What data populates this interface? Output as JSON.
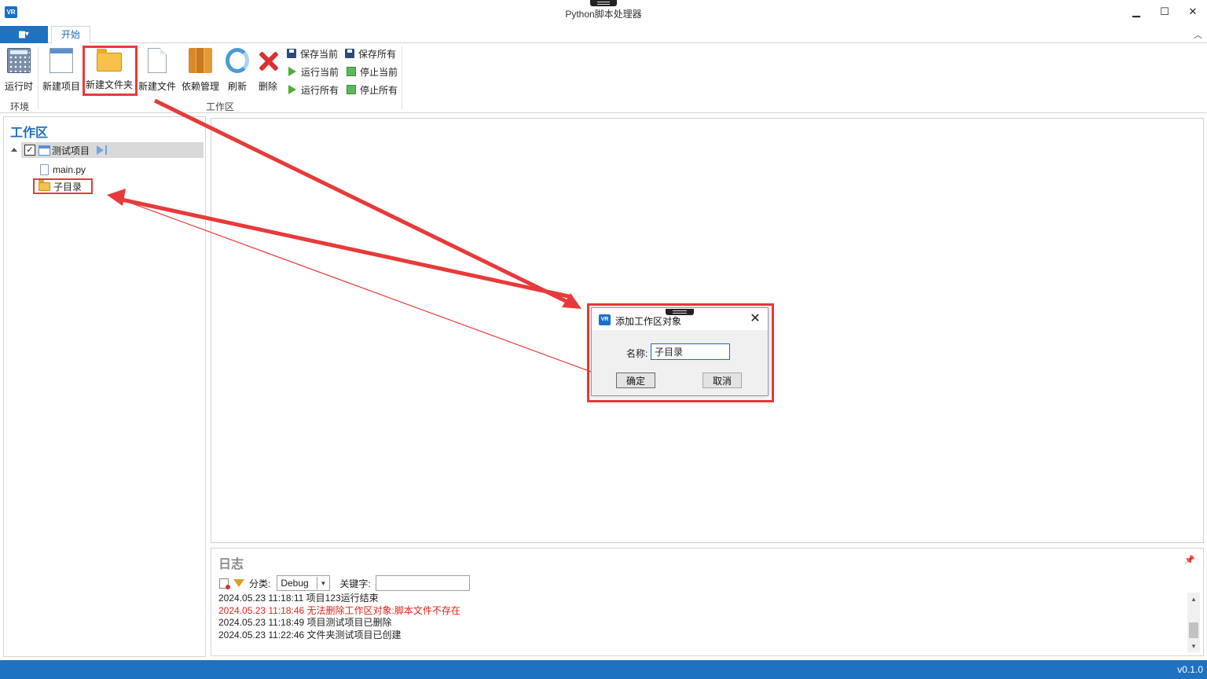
{
  "window": {
    "title": "Python脚本处理器",
    "logo_text": "VR",
    "minimize": "▁",
    "maximize": "☐",
    "close": "✕"
  },
  "ribbon": {
    "file_menu": "▆▾",
    "tabs": [
      {
        "label": "开始"
      }
    ],
    "collapse": "︿",
    "groups": [
      {
        "label": "环境"
      },
      {
        "label": "工作区"
      }
    ],
    "large_buttons": [
      {
        "label": "运行时",
        "icon": "calculator-icon"
      },
      {
        "label": "新建项目",
        "icon": "window-icon"
      },
      {
        "label": "新建文件夹",
        "icon": "folder-open-icon"
      },
      {
        "label": "新建文件",
        "icon": "file-icon"
      },
      {
        "label": "依赖管理",
        "icon": "books-icon"
      },
      {
        "label": "刷新",
        "icon": "refresh-icon"
      },
      {
        "label": "删除",
        "icon": "delete-x-icon"
      }
    ],
    "small_buttons": [
      {
        "label": "保存当前",
        "icon": "save-icon"
      },
      {
        "label": "运行当前",
        "icon": "play-icon"
      },
      {
        "label": "运行所有",
        "icon": "play-icon"
      },
      {
        "label": "保存所有",
        "icon": "save-all-icon"
      },
      {
        "label": "停止当前",
        "icon": "stop-icon"
      },
      {
        "label": "停止所有",
        "icon": "stop-icon"
      }
    ]
  },
  "workspace": {
    "title": "工作区",
    "check_mark": "✓",
    "project": {
      "name": "测试项目",
      "checked": true
    },
    "children": [
      {
        "name": "main.py",
        "type": "file"
      },
      {
        "name": "子目录",
        "type": "folder"
      }
    ]
  },
  "log": {
    "title": "日志",
    "pin": "📌",
    "category_label": "分类:",
    "category_value": "Debug",
    "select_arrow": "▾",
    "keyword_label": "关键字:",
    "keyword_value": "",
    "scroll_up": "▴",
    "scroll_down": "▾",
    "entries": [
      {
        "text": "2024.05.23 11:18:11 项目123运行结束",
        "level": "info"
      },
      {
        "text": "2024.05.23 11:18:46 无法删除工作区对象:脚本文件不存在",
        "level": "error"
      },
      {
        "text": "2024.05.23 11:18:49 项目测试项目已删除",
        "level": "info"
      },
      {
        "text": "2024.05.23 11:22:46 文件夹测试项目已创建",
        "level": "info"
      }
    ],
    "error_color": "#e0241a"
  },
  "dialog": {
    "title": "添加工作区对象",
    "logo_text": "VR",
    "close": "✕",
    "name_label": "名称:",
    "name_value": "子目录",
    "ok": "确定",
    "cancel": "取消"
  },
  "status": {
    "version": "v0.1.0"
  },
  "colors": {
    "accent": "#1d72c2",
    "annotation": "#e83a3a"
  }
}
